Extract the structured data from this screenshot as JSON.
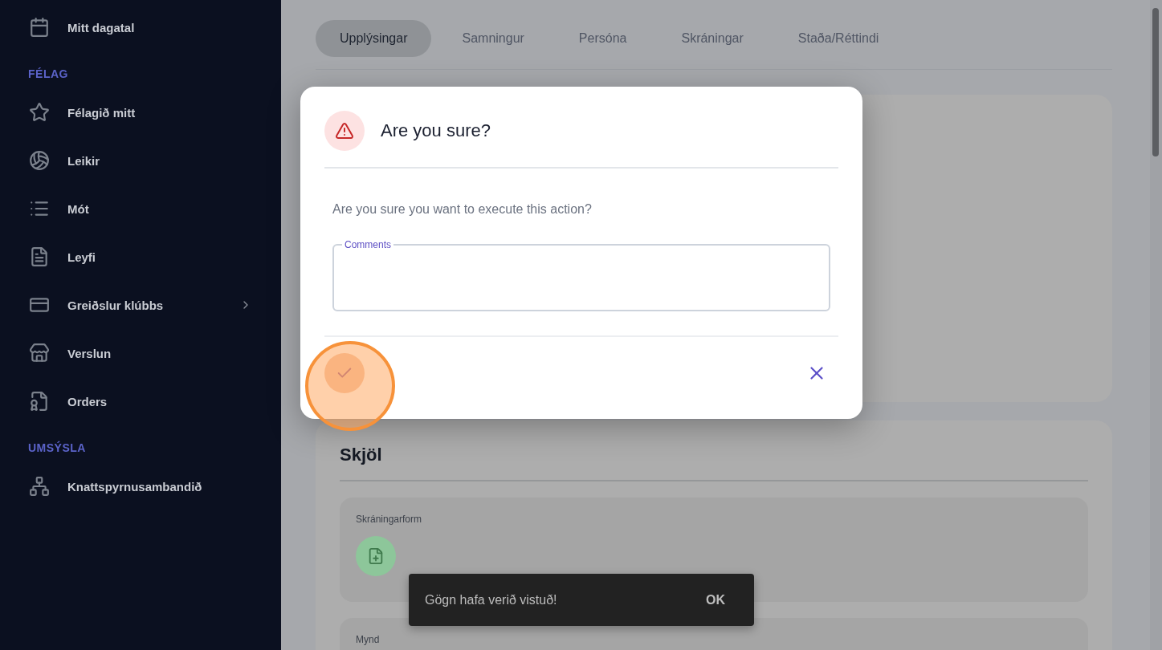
{
  "sidebar": {
    "items": [
      {
        "kind": "item",
        "label": "Mitt dagatal",
        "expandable": false
      },
      {
        "kind": "header",
        "label": "FÉLAG"
      },
      {
        "kind": "item",
        "label": "Félagið mitt",
        "expandable": false
      },
      {
        "kind": "item",
        "label": "Leikir",
        "expandable": false
      },
      {
        "kind": "item",
        "label": "Mót",
        "expandable": false
      },
      {
        "kind": "item",
        "label": "Leyfi",
        "expandable": false
      },
      {
        "kind": "item",
        "label": "Greiðslur klúbbs",
        "expandable": true
      },
      {
        "kind": "item",
        "label": "Verslun",
        "expandable": false
      },
      {
        "kind": "item",
        "label": "Orders",
        "expandable": false
      },
      {
        "kind": "header",
        "label": "UMSÝSLA"
      },
      {
        "kind": "item",
        "label": "Knattspyrnusambandið",
        "expandable": false
      }
    ]
  },
  "tabs": [
    {
      "label": "Upplýsingar",
      "selected": true
    },
    {
      "label": "Samningur",
      "selected": false
    },
    {
      "label": "Persóna",
      "selected": false
    },
    {
      "label": "Skráningar",
      "selected": false
    },
    {
      "label": "Staða/Réttindi",
      "selected": false
    }
  ],
  "documents": {
    "title": "Skjöl",
    "fields": [
      {
        "label": "Skráningarform"
      },
      {
        "label": "Mynd"
      }
    ]
  },
  "dialog": {
    "title": "Are you sure?",
    "message": "Are you sure you want to execute this action?",
    "comments": {
      "label": "Comments"
    }
  },
  "snackbar": {
    "message": "Gögn hafa verið vistuð!",
    "action": "OK"
  }
}
